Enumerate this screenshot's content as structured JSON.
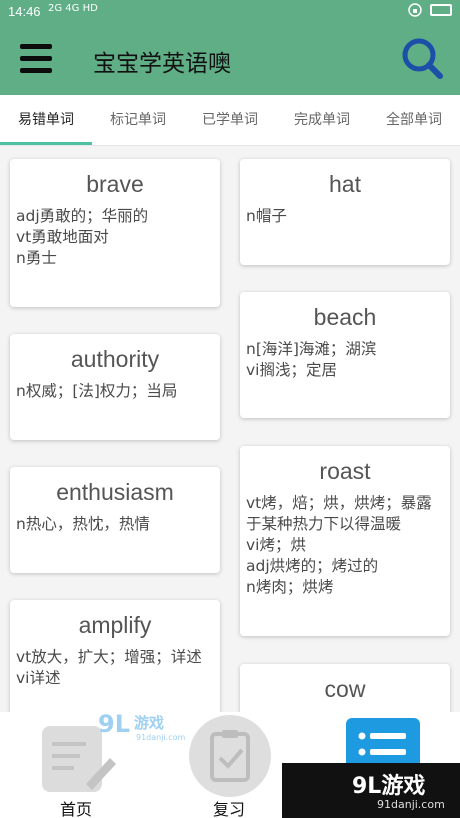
{
  "status_bar": {
    "time": "14:46",
    "signal": "2G 4G HD"
  },
  "app_bar": {
    "title": "宝宝学英语噢"
  },
  "tabs": [
    {
      "label": "易错单词",
      "active": true
    },
    {
      "label": "标记单词",
      "active": false
    },
    {
      "label": "已学单词",
      "active": false
    },
    {
      "label": "完成单词",
      "active": false
    },
    {
      "label": "全部单词",
      "active": false
    }
  ],
  "cards_left": [
    {
      "word": "brave",
      "defs": [
        "adj勇敢的；华丽的",
        "vt勇敢地面对",
        "n勇士"
      ]
    },
    {
      "word": "authority",
      "defs": [
        "n权威；[法]权力；当局"
      ]
    },
    {
      "word": "enthusiasm",
      "defs": [
        "n热心，热忱，热情"
      ]
    },
    {
      "word": "amplify",
      "defs": [
        "vt放大，扩大；增强；详述",
        "vi详述"
      ]
    }
  ],
  "cards_right": [
    {
      "word": "hat",
      "defs": [
        "n帽子"
      ]
    },
    {
      "word": "beach",
      "defs": [
        "n[海洋]海滩；湖滨",
        "vi搁浅；定居"
      ]
    },
    {
      "word": "roast",
      "defs": [
        "vt烤，焙；烘，烘烤；暴露于某种热力下以得温暖",
        "vi烤；烘",
        "adj烘烤的；烤过的",
        "n烤肉；烘烤"
      ]
    },
    {
      "word": "cow",
      "defs": []
    }
  ],
  "bottom_nav": [
    {
      "label": "首页",
      "icon": "edit-icon"
    },
    {
      "label": "复习",
      "icon": "checklist-icon"
    },
    {
      "label": "",
      "icon": "list-icon"
    }
  ],
  "watermark": {
    "brand": "9L游戏",
    "url": "91danji.com"
  },
  "colors": {
    "primary": "#5fae86",
    "accent": "#4fc0a3",
    "search": "#1c4fa8",
    "list_btn": "#1e9be0"
  }
}
